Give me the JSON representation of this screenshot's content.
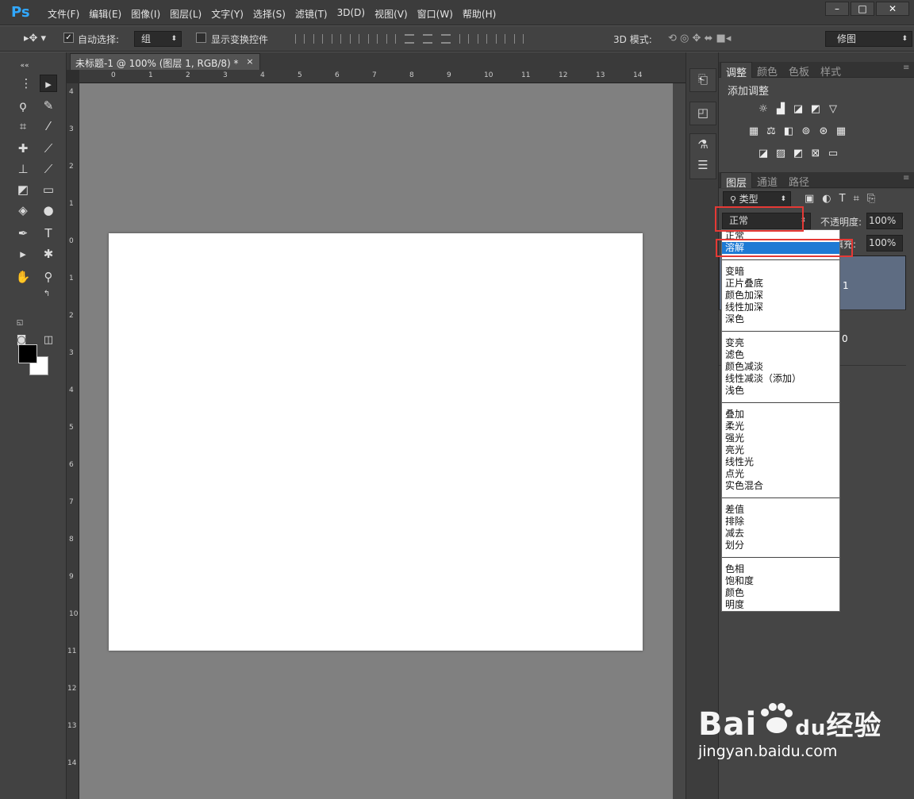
{
  "app": {
    "logo": "Ps"
  },
  "menu": [
    "文件(F)",
    "编辑(E)",
    "图像(I)",
    "图层(L)",
    "文字(Y)",
    "选择(S)",
    "滤镜(T)",
    "3D(D)",
    "视图(V)",
    "窗口(W)",
    "帮助(H)"
  ],
  "window_controls": {
    "minimize": "–",
    "maximize": "□",
    "close": "✕"
  },
  "options_bar": {
    "auto_select_label": "自动选择:",
    "auto_select_checked": true,
    "auto_select_value": "组",
    "show_transform_label": "显示变换控件",
    "mode_3d_label": "3D 模式:",
    "workspace_value": "修图"
  },
  "document": {
    "tab_title": "未标题-1 @ 100% (图层 1, RGB/8) *",
    "close_symbol": "×",
    "h_ruler_labels": [
      "0",
      "1",
      "2",
      "3",
      "4",
      "5",
      "6",
      "7",
      "8",
      "9",
      "10",
      "11",
      "12",
      "13",
      "14"
    ],
    "v_ruler_labels": [
      "4",
      "3",
      "2",
      "1",
      "0",
      "1",
      "2",
      "3",
      "4",
      "5",
      "6",
      "7",
      "8",
      "9",
      "10",
      "11",
      "12",
      "13",
      "14"
    ]
  },
  "panels": {
    "top_tabs": [
      "调整",
      "颜色",
      "色板",
      "样式"
    ],
    "adjust_title": "添加调整",
    "layer_tabs": [
      "图层",
      "通道",
      "路径"
    ],
    "filter_kind": "类型",
    "blend_mode": "正常",
    "opacity_label": "不透明度:",
    "opacity_value": "100%",
    "fill_label": "填充:",
    "fill_value": "100%",
    "layers": [
      {
        "name": "1"
      },
      {
        "name": "0"
      }
    ]
  },
  "blend_dropdown": {
    "groups": [
      [
        "正常",
        "溶解"
      ],
      [
        "变暗",
        "正片叠底",
        "颜色加深",
        "线性加深",
        "深色"
      ],
      [
        "变亮",
        "滤色",
        "颜色减淡",
        "线性减淡（添加）",
        "浅色"
      ],
      [
        "叠加",
        "柔光",
        "强光",
        "亮光",
        "线性光",
        "点光",
        "实色混合"
      ],
      [
        "差值",
        "排除",
        "减去",
        "划分"
      ],
      [
        "色相",
        "饱和度",
        "颜色",
        "明度"
      ]
    ],
    "highlighted": "溶解"
  },
  "watermark": {
    "brand": "Bai",
    "brand_suffix": "du",
    "cn": "经验",
    "url": "jingyan.baidu.com"
  },
  "colors": {
    "accent_blue": "#1e7ad4",
    "highlight_red": "#e53935",
    "ps_blue": "#31a8ff"
  }
}
